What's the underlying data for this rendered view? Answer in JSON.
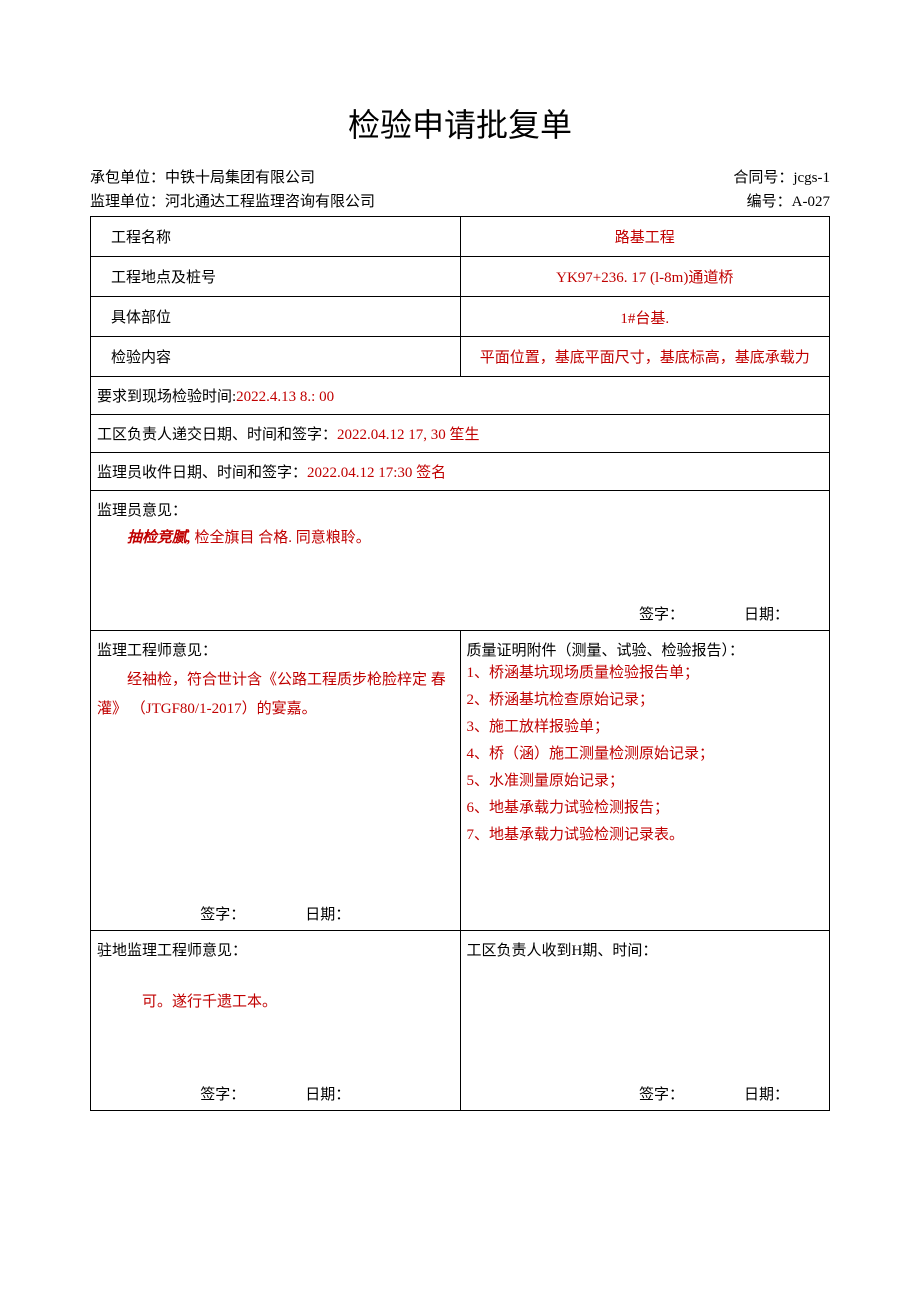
{
  "title": "检验申请批复单",
  "header": {
    "contractor_label": "承包单位：",
    "contractor": "中铁十局集团有限公司",
    "contract_no_label": "合同号：",
    "contract_no": "jcgs-1",
    "supervisor_label": "监理单位：",
    "supervisor": "河北通达工程监理咨询有限公司",
    "serial_label": "编号：",
    "serial": "A-027"
  },
  "rows": {
    "project_name_label": "工程名称",
    "project_name": "路基工程",
    "location_label": "工程地点及桩号",
    "location": "YK97+236. 17 (l-8m)通道桥",
    "part_label": "具体部位",
    "part": "1#台基.",
    "content_label": "检验内容",
    "content": "平面位置，基底平面尺寸，基底标高，基底承载力",
    "req_time_label": "要求到现场检验时间:",
    "req_time": "2022.4.13 8.: 00",
    "submit_label": "工区负责人递交日期、时间和签字：",
    "submit_val": "2022.04.12       17, 30 笙生",
    "receive_label": "监理员收件日期、时间和签字：",
    "receive_val": "2022.04.12       17:30 签名"
  },
  "opinions": {
    "supervisor_member_label": "监理员意见：",
    "supervisor_member_body1": "抽检竞腻,",
    "supervisor_member_body2": "检全旗目   合格. 同意粮聆。",
    "engineer_label": "监理工程师意见：",
    "engineer_body": "经袖检，符合世计含《公路工程质步枪脸梓定 春灌》  （JTGF80/1-2017）的宴嘉。",
    "attachments_label": "质量证明附件（测量、试验、检验报告）：",
    "attachments": [
      "1、桥涵基坑现场质量检验报告单；",
      "2、桥涵基坑检查原始记录；",
      "3、施工放样报验单；",
      "4、桥（涵）施工测量检测原始记录；",
      "5、水准测量原始记录；",
      "6、地基承载力试验检测报告；",
      "7、地基承载力试验检测记录表。"
    ],
    "resident_label": "驻地监理工程师意见：",
    "resident_body": "可。遂行千遗工本。",
    "receipt_label": "工区负责人收到H期、时间："
  },
  "sig": {
    "sign": "签字：",
    "date": "日期："
  }
}
